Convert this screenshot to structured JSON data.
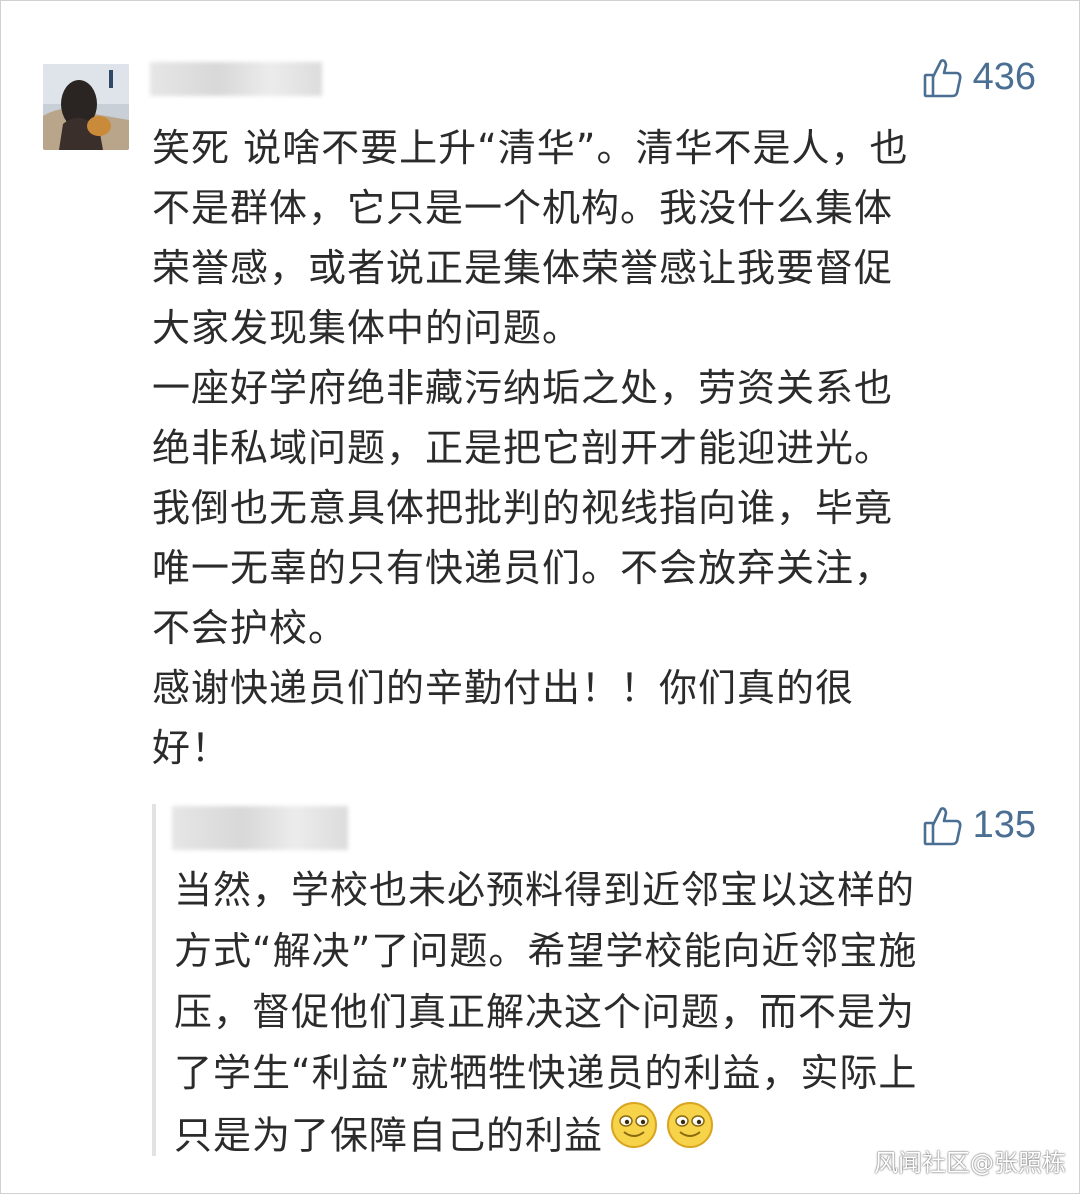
{
  "comment": {
    "likes": "436",
    "paragraphs": [
      "笑死 说啥不要上升“清华”。清华不是人，也\n不是群体，它只是一个机构。我没什么集体\n荣誉感，或者说正是集体荣誉感让我要督促\n大家发现集体中的问题。",
      "一座好学府绝非藏污纳垢之处，劳资关系也\n绝非私域问题，正是把它剖开才能迎进光。",
      "我倒也无意具体把批判的视线指向谁，毕竟\n唯一无辜的只有快递员们。不会放弃关注，\n不会护校。",
      "感谢快递员们的辛勤付出！！你们真的很\n好！"
    ]
  },
  "reply": {
    "likes": "135",
    "text": "当然，学校也未必预料得到近邻宝以这样的\n方式“解决”了问题。希望学校能向近邻宝施\n压，督促他们真正解决这个问题，而不是为\n了学生“利益”就牺牲快递员的利益，实际上\n只是为了保障自己的利益"
  },
  "watermark": "风闻社区@张照栋",
  "icons": {
    "like": "thumbs-up-icon",
    "emoji": "smiley-icon"
  },
  "colors": {
    "likes": "#4a6f93",
    "text": "#2b2b2b"
  }
}
